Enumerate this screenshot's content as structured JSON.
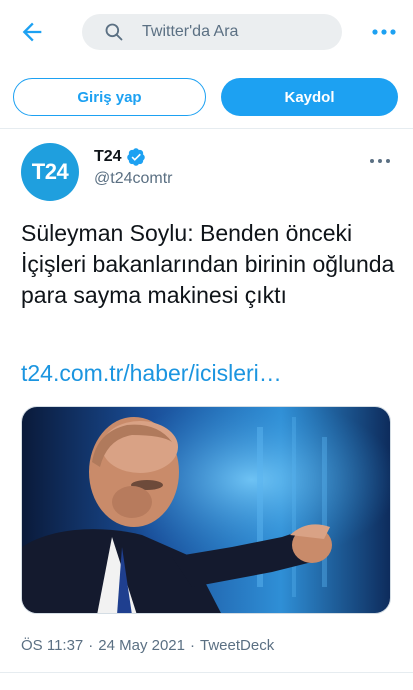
{
  "header": {
    "search_placeholder": "Twitter'da Ara"
  },
  "auth": {
    "login_label": "Giriş yap",
    "signup_label": "Kaydol"
  },
  "tweet": {
    "author_name": "T24",
    "author_handle": "@t24comtr",
    "avatar_text": "T24",
    "text": "Süleyman Soylu: Benden önceki İçişleri bakanlarından birinin oğlunda para sayma makinesi çıktı",
    "link": "t24.com.tr/haber/icisleri…",
    "time": "ÖS 11:37",
    "separator": "·",
    "date": "24 May 2021",
    "source": "TweetDeck"
  },
  "colors": {
    "accent": "#1da1f2",
    "avatar_bg": "#1f9fde",
    "muted": "#5b7083",
    "search_bg": "#ebeef0"
  },
  "icons": [
    "back-arrow-icon",
    "search-icon",
    "more-icon",
    "verified-badge-icon"
  ]
}
